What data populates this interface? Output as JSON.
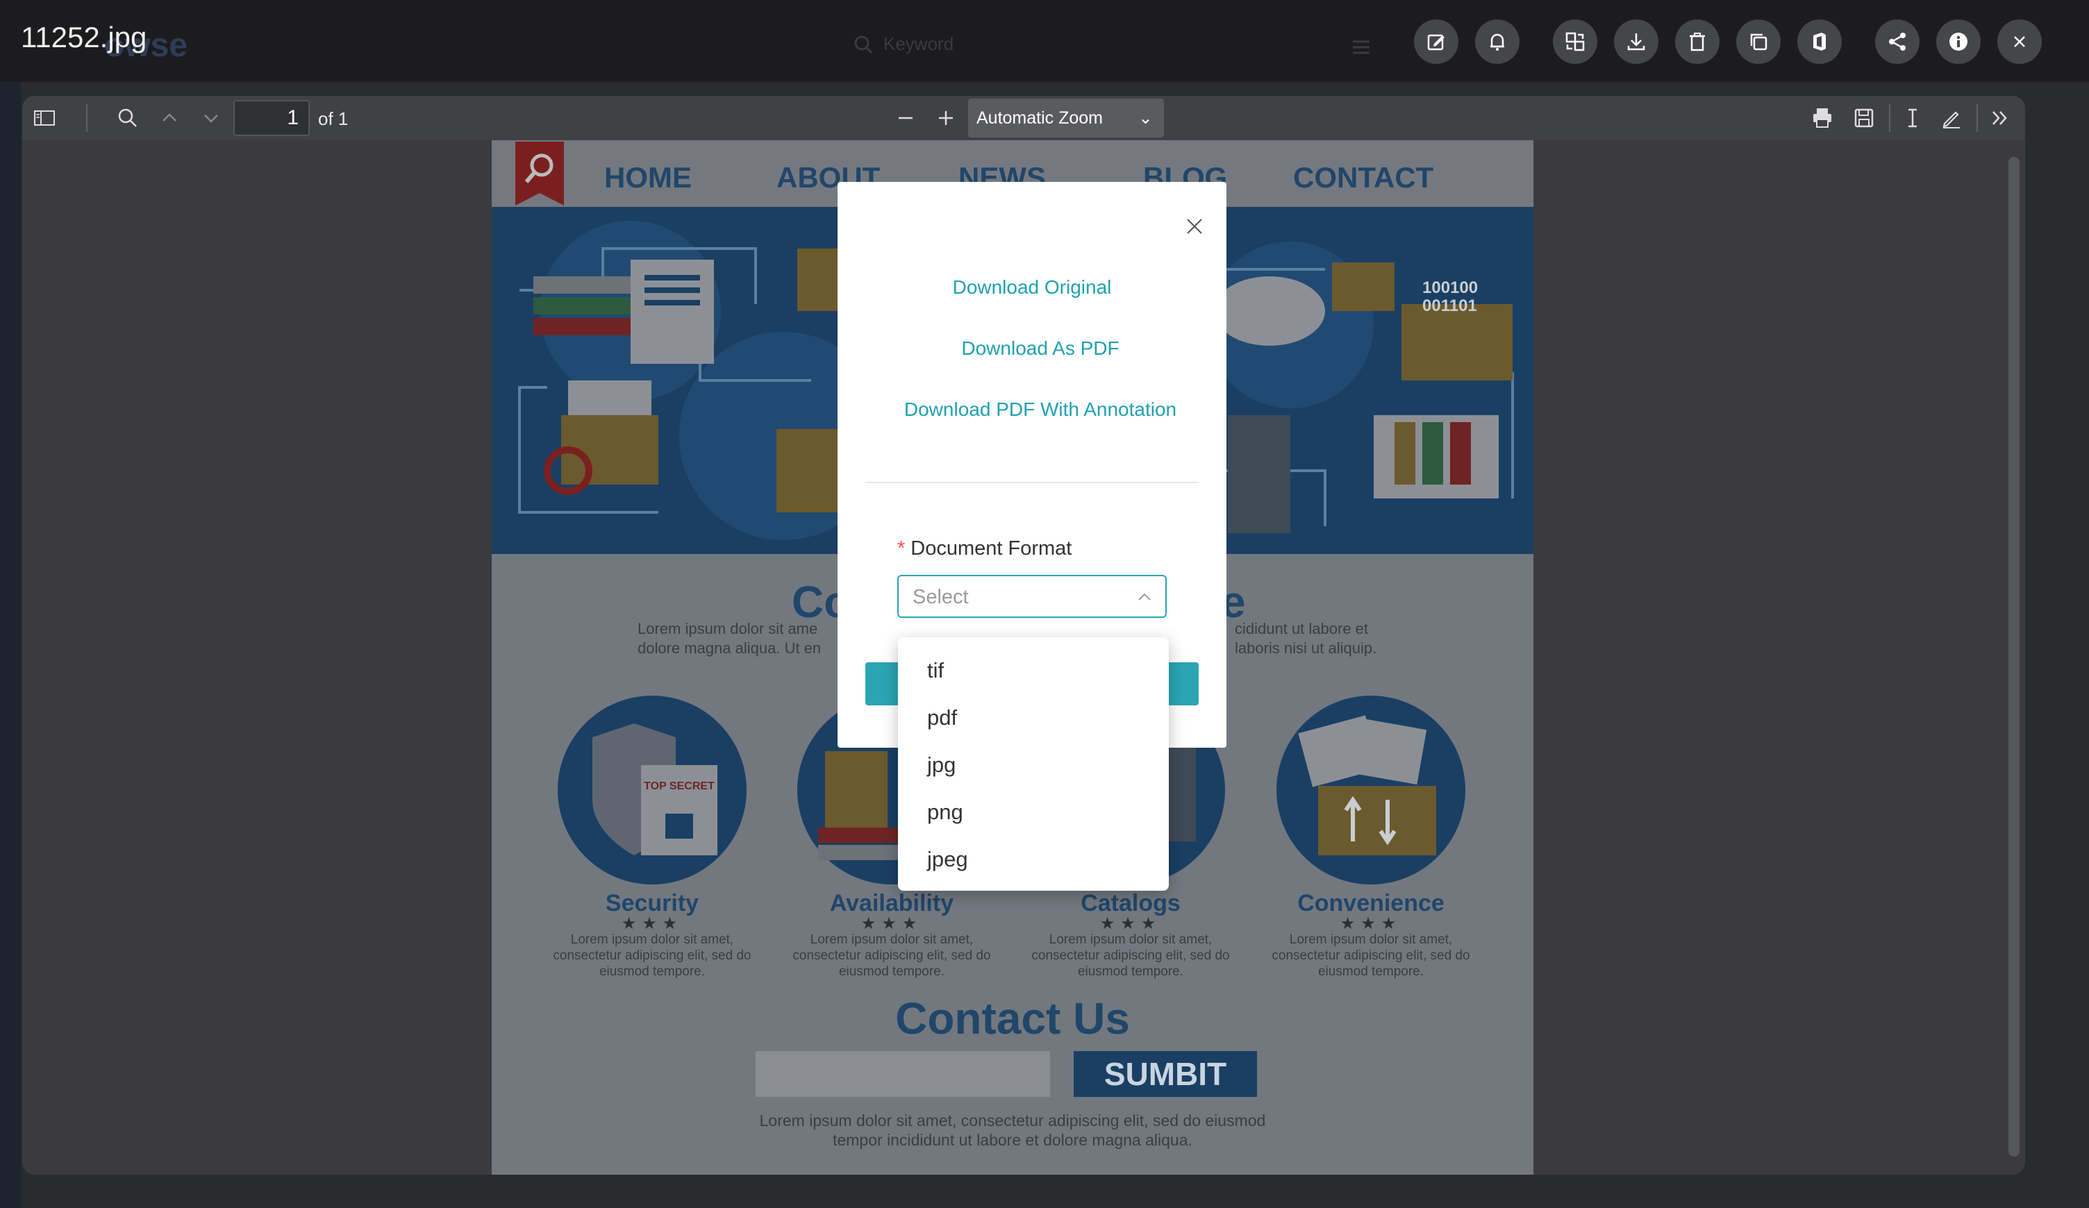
{
  "window": {
    "filename": "11252.jpg",
    "ghost_brand": "owse"
  },
  "topbar": {
    "search_placeholder": "Keyword",
    "icons": [
      "edit-icon",
      "bell-icon",
      "convert-icon",
      "download-icon",
      "trash-icon",
      "copy-icon",
      "office-icon",
      "share-icon",
      "info-icon",
      "close-icon"
    ]
  },
  "viewer_toolbar": {
    "page_number": "1",
    "page_of": "of 1",
    "zoom": "Automatic Zoom"
  },
  "document": {
    "nav": [
      "HOME",
      "ABOUT",
      "NEWS",
      "BLOG",
      "CONTACT"
    ],
    "title_left": "Co",
    "title_right": "e",
    "lorem_left": "Lorem ipsum dolor sit ame",
    "lorem_left2": "dolore magna aliqua. Ut en",
    "lorem_right": "cididunt ut labore et",
    "lorem_right2": "laboris nisi ut aliquip.",
    "features": [
      {
        "name": "Security",
        "stars": "★★★",
        "text": "Lorem ipsum dolor sit amet, consectetur adipiscing elit, sed do eiusmod tempore."
      },
      {
        "name": "Availability",
        "stars": "★★★",
        "text": "Lorem ipsum dolor sit amet, consectetur adipiscing elit, sed do eiusmod tempore."
      },
      {
        "name": "Catalogs",
        "stars": "★★★",
        "text": "Lorem ipsum dolor sit amet, consectetur adipiscing elit, sed do eiusmod tempore."
      },
      {
        "name": "Convenience",
        "stars": "★★★",
        "text": "Lorem ipsum dolor sit amet, consectetur adipiscing elit, sed do eiusmod tempore."
      }
    ],
    "contact_title": "Contact Us",
    "submit": "SUMBIT",
    "contact_lorem": "Lorem ipsum dolor sit amet, consectetur adipiscing elit, sed do eiusmod tempor incididunt ut labore et dolore magna aliqua.",
    "hero_text_1": "100100",
    "hero_text_2": "001101",
    "badge": "TOP SECRET"
  },
  "modal": {
    "links": [
      "Download Original",
      "Download As PDF",
      "Download PDF With Annotation"
    ],
    "required_mark": "*",
    "format_label": "Document Format",
    "select_placeholder": "Select",
    "options": [
      "tif",
      "pdf",
      "jpg",
      "png",
      "jpeg"
    ]
  }
}
